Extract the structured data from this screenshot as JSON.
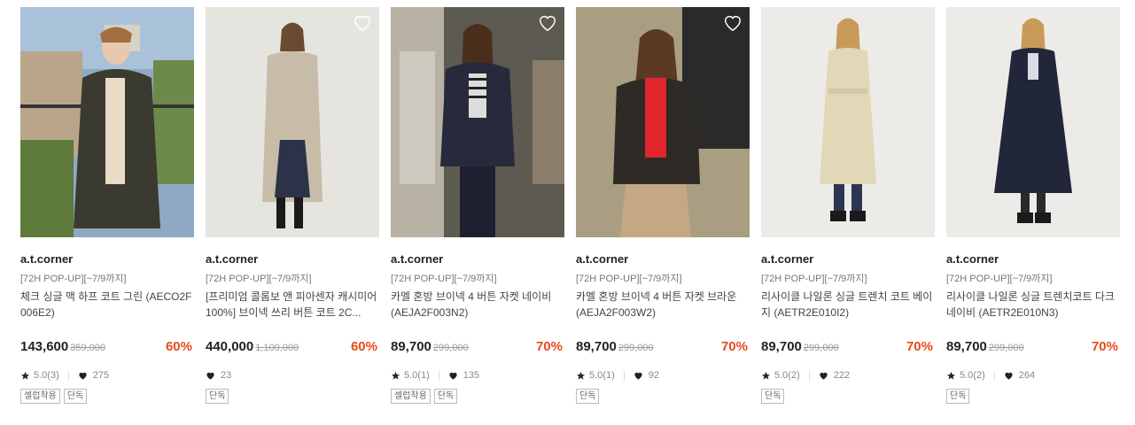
{
  "products": [
    {
      "brand": "a.t.corner",
      "tag": "[72H POP-UP][~7/9까지]",
      "name": "체크 싱글 맥 하프 코트 그린 (AECO2F006E2)",
      "price": "143,600",
      "original_price": "359,000",
      "discount": "60%",
      "rating": "5.0(3)",
      "likes": "275",
      "badges": [
        "셀럽착용",
        "단독"
      ]
    },
    {
      "brand": "a.t.corner",
      "tag": "[72H POP-UP][~7/9까지]",
      "name": "[프리미엄 콜롬보 앤 피아센자 캐시미어 100%] 브이넥 쓰리 버튼 코트 2C...",
      "price": "440,000",
      "original_price": "1,100,000",
      "discount": "60%",
      "rating": "",
      "likes": "23",
      "badges": [
        "단독"
      ]
    },
    {
      "brand": "a.t.corner",
      "tag": "[72H POP-UP][~7/9까지]",
      "name": "카멜 혼방 브이넥 4 버튼 자켓 네이비 (AEJA2F003N2)",
      "price": "89,700",
      "original_price": "299,000",
      "discount": "70%",
      "rating": "5.0(1)",
      "likes": "135",
      "badges": [
        "셀럽착용",
        "단독"
      ]
    },
    {
      "brand": "a.t.corner",
      "tag": "[72H POP-UP][~7/9까지]",
      "name": "카멜 혼방 브이넥 4 버튼 자켓 브라운 (AEJA2F003W2)",
      "price": "89,700",
      "original_price": "299,000",
      "discount": "70%",
      "rating": "5.0(1)",
      "likes": "92",
      "badges": [
        "단독"
      ]
    },
    {
      "brand": "a.t.corner",
      "tag": "[72H POP-UP][~7/9까지]",
      "name": "리사이클 나일론 싱글 트렌치 코트 베이지 (AETR2E010I2)",
      "price": "89,700",
      "original_price": "299,000",
      "discount": "70%",
      "rating": "5.0(2)",
      "likes": "222",
      "badges": [
        "단독"
      ]
    },
    {
      "brand": "a.t.corner",
      "tag": "[72H POP-UP][~7/9까지]",
      "name": "리사이클 나일론 싱글 트렌치코트 다크네이비 (AETR2E010N3)",
      "price": "89,700",
      "original_price": "299,000",
      "discount": "70%",
      "rating": "5.0(2)",
      "likes": "264",
      "badges": [
        "단독"
      ]
    }
  ],
  "colors": {
    "discount": "#e8491d",
    "price": "#222222",
    "muted": "#888888"
  }
}
